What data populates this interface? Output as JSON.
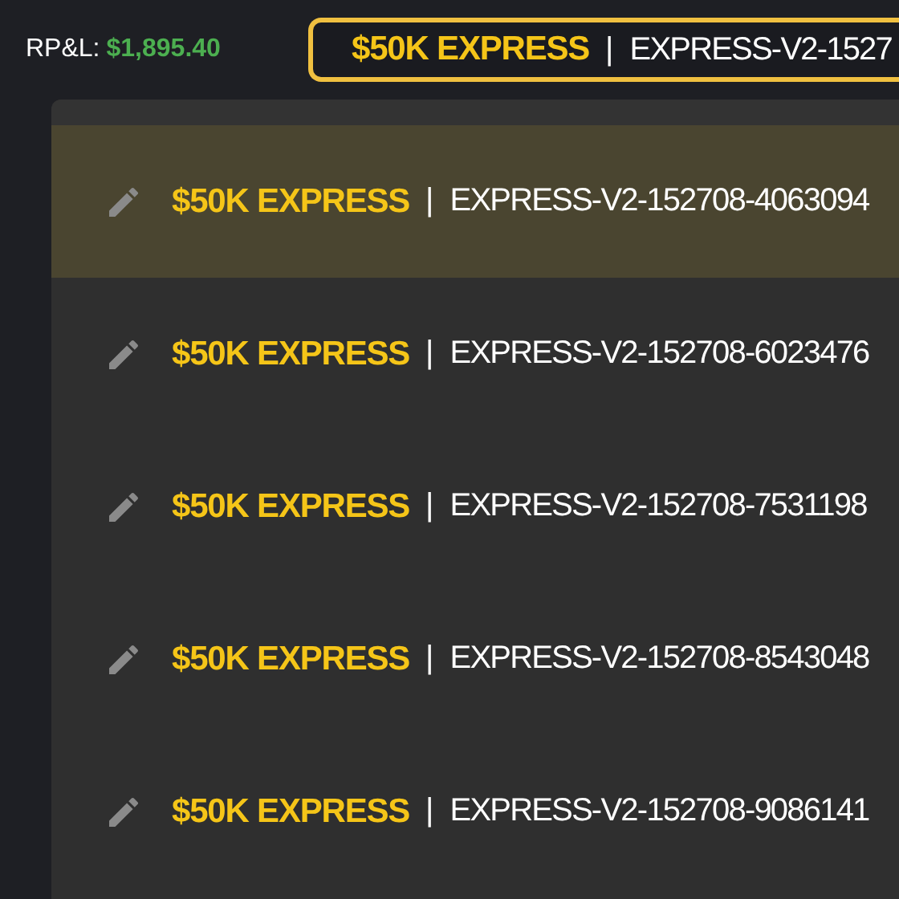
{
  "header": {
    "pnl_label": "RP&L:",
    "pnl_value": "$1,895.40"
  },
  "account_selector": {
    "name": "$50K EXPRESS",
    "separator": "|",
    "id": "EXPRESS-V2-1527"
  },
  "accounts": [
    {
      "name": "$50K EXPRESS",
      "separator": "|",
      "id": "EXPRESS-V2-152708-4063094",
      "selected": true
    },
    {
      "name": "$50K EXPRESS",
      "separator": "|",
      "id": "EXPRESS-V2-152708-6023476",
      "selected": false
    },
    {
      "name": "$50K EXPRESS",
      "separator": "|",
      "id": "EXPRESS-V2-152708-7531198",
      "selected": false
    },
    {
      "name": "$50K EXPRESS",
      "separator": "|",
      "id": "EXPRESS-V2-152708-8543048",
      "selected": false
    },
    {
      "name": "$50K EXPRESS",
      "separator": "|",
      "id": "EXPRESS-V2-152708-9086141",
      "selected": false
    }
  ]
}
